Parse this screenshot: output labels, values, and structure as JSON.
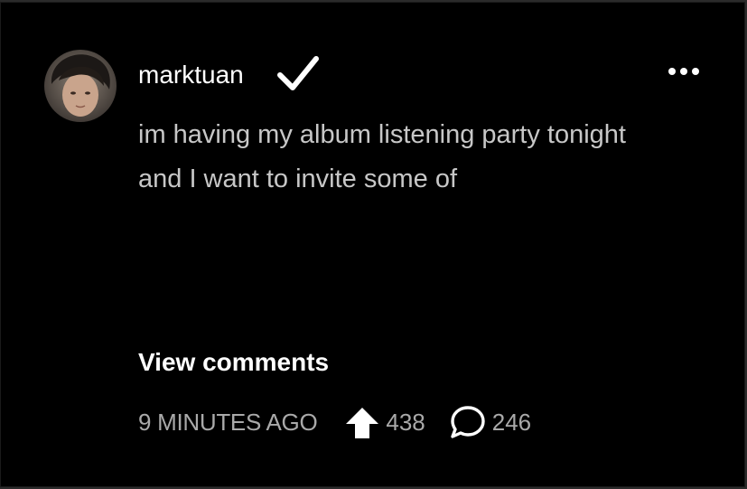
{
  "post": {
    "username": "marktuan",
    "text_lines": [
      "im having my album listening party tonight",
      "and I want to invite some of"
    ],
    "view_comments_label": "View comments",
    "timestamp": "9 MINUTES AGO",
    "upvotes": "438",
    "comments": "246"
  },
  "icons": {
    "verified": "checkmark-icon",
    "more": "more-options-icon",
    "upvote": "arrow-up-icon",
    "comment": "speech-bubble-icon"
  },
  "colors": {
    "background": "#000000",
    "text_primary": "#ffffff",
    "text_body": "#c7c7c7",
    "text_meta": "#a9a9a9"
  }
}
